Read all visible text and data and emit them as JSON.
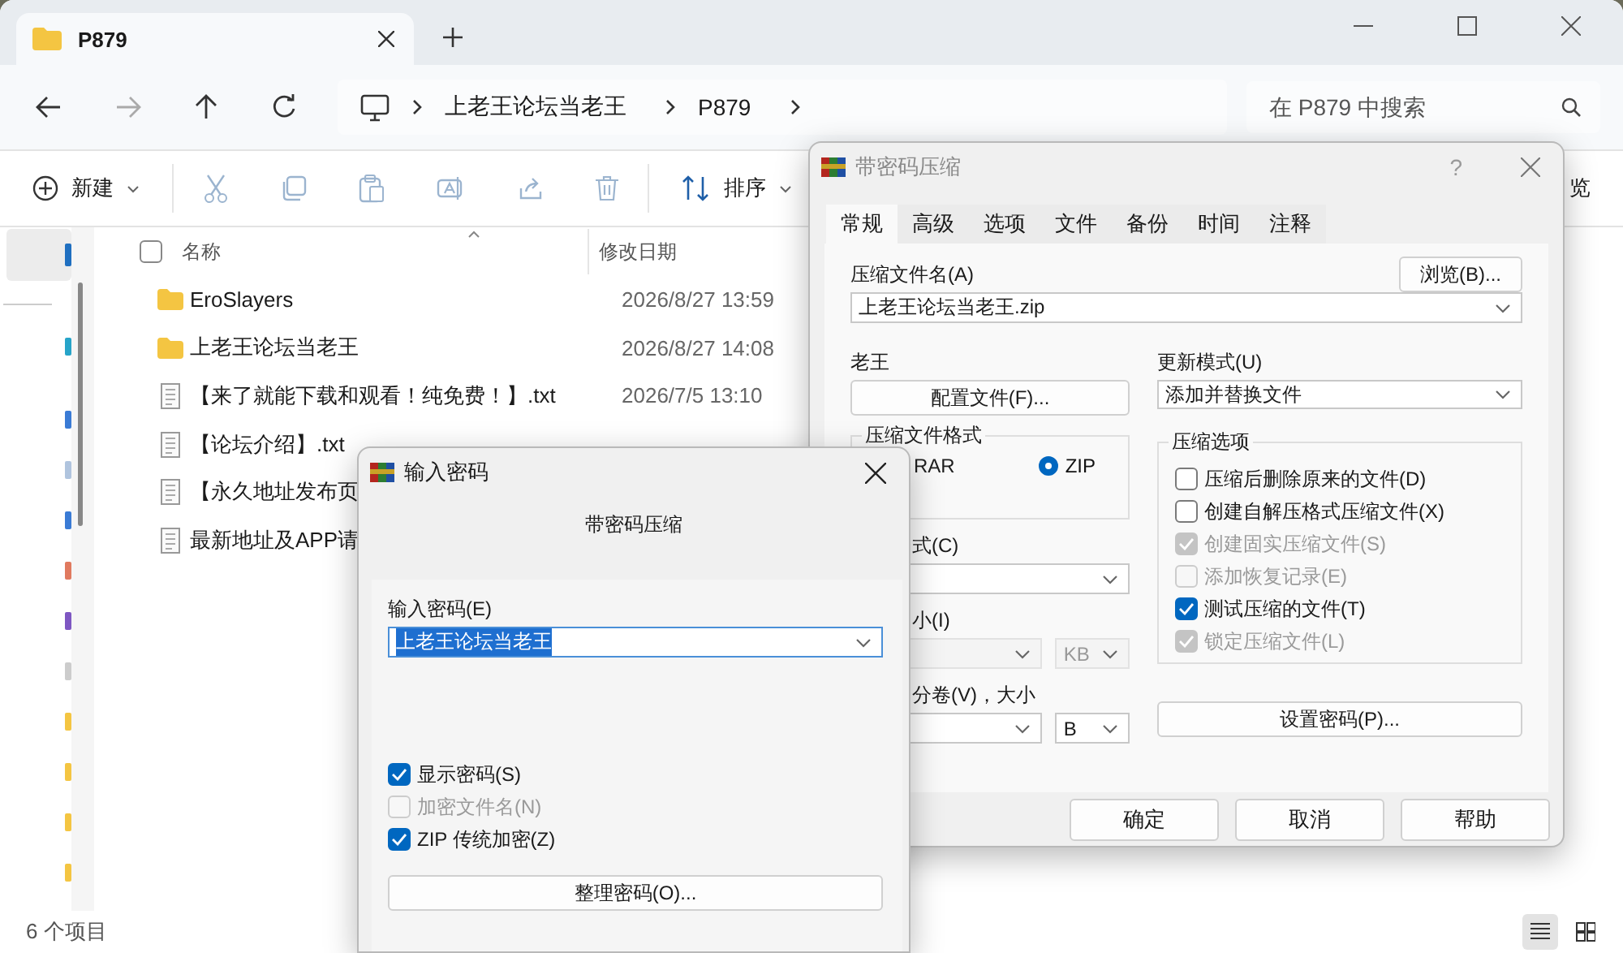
{
  "explorer": {
    "tab_title": "P879",
    "breadcrumb": [
      "上老王论坛当老王",
      "P879"
    ],
    "search": {
      "placeholder": "在 P879 中搜索"
    },
    "toolbar": {
      "new": "新建",
      "sort": "排序",
      "cut_off": "览"
    },
    "columns": [
      "名称",
      "修改日期"
    ],
    "select_all_checked": false,
    "files": [
      {
        "kind": "folder",
        "name": "EroSlayers",
        "modified": "2026/8/27 13:59"
      },
      {
        "kind": "folder",
        "name": "上老王论坛当老王",
        "modified": "2026/8/27 14:08"
      },
      {
        "kind": "text",
        "name": "【来了就能下载和观看！纯免费！】.txt",
        "modified": "2026/7/5 13:10"
      },
      {
        "kind": "text",
        "name": "【论坛介绍】.txt"
      },
      {
        "kind": "text",
        "name": "【永久地址发布页"
      },
      {
        "kind": "text",
        "name": "最新地址及APP请"
      }
    ],
    "status": "6 个项目",
    "views": [
      {
        "kind": "details",
        "selected": true
      },
      {
        "kind": "tiles",
        "selected": false
      }
    ]
  },
  "archive_dialog": {
    "title": "带密码压缩",
    "help": "?",
    "tabs": [
      {
        "label": "常规",
        "selected": true
      },
      {
        "label": "高级",
        "selected": false
      },
      {
        "label": "选项",
        "selected": false
      },
      {
        "label": "文件",
        "selected": false
      },
      {
        "label": "备份",
        "selected": false
      },
      {
        "label": "时间",
        "selected": false
      },
      {
        "label": "注释",
        "selected": false
      }
    ],
    "archive_name_label": "压缩文件名(A)",
    "browse": "浏览(B)...",
    "archive_name": "上老王论坛当老王.zip",
    "profile_label": "老王",
    "profile_button": "配置文件(F)...",
    "update_label": "更新模式(U)",
    "update_mode": "添加并替换文件",
    "format_title": "压缩文件格式",
    "formats": [
      {
        "label": "RAR",
        "selected": false
      },
      {
        "label": "ZIP",
        "selected": true
      }
    ],
    "method_label": "式(C)",
    "dict_label": "小(I)",
    "dict_unit": "KB",
    "volume_label": "分卷(V)，大小",
    "volume_unit": "B",
    "options_title": "压缩选项",
    "options": [
      {
        "label": "压缩后删除原来的文件(D)",
        "checked": false,
        "disabled": false
      },
      {
        "label": "创建自解压格式压缩文件(X)",
        "checked": false,
        "disabled": false
      },
      {
        "label": "创建固实压缩文件(S)",
        "checked": true,
        "disabled": true
      },
      {
        "label": "添加恢复记录(E)",
        "checked": false,
        "disabled": true
      },
      {
        "label": "测试压缩的文件(T)",
        "checked": true,
        "disabled": false
      },
      {
        "label": "锁定压缩文件(L)",
        "checked": true,
        "disabled": true
      }
    ],
    "set_password": "设置密码(P)...",
    "buttons": [
      "确定",
      "取消",
      "帮助"
    ]
  },
  "password_dialog": {
    "title": "输入密码",
    "subtitle": "带密码压缩",
    "label": "输入密码(E)",
    "value": "上老王论坛当老王",
    "value_selected": true,
    "options": [
      {
        "label": "显示密码(S)",
        "checked": true,
        "disabled": false
      },
      {
        "label": "加密文件名(N)",
        "checked": false,
        "disabled": true
      },
      {
        "label": "ZIP 传统加密(Z)",
        "checked": true,
        "disabled": false
      }
    ],
    "manage": "整理密码(O)..."
  }
}
